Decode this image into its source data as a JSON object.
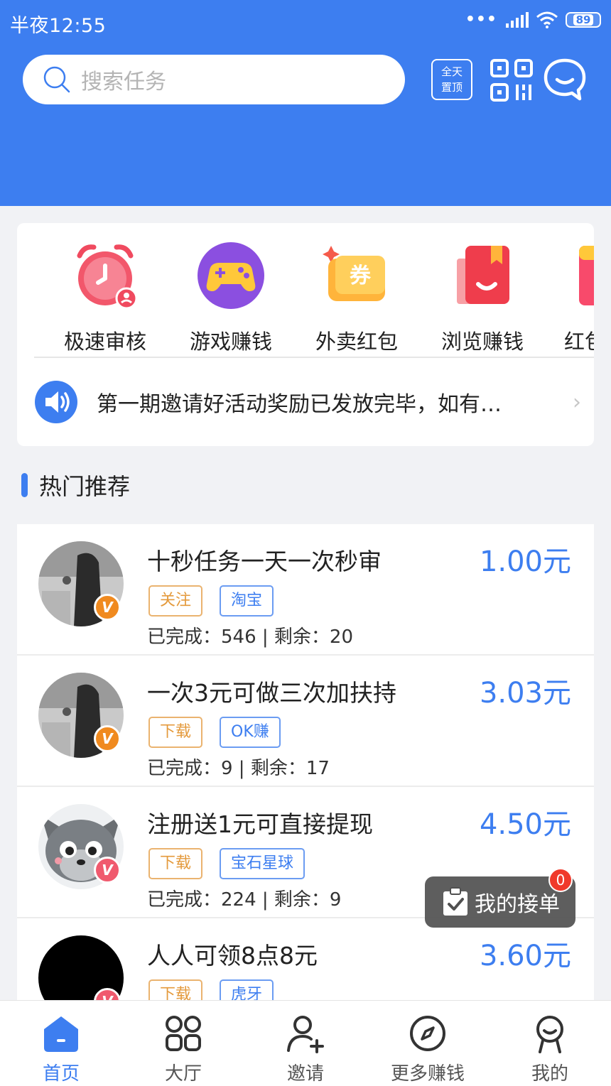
{
  "status_bar": {
    "time": "半夜12:55",
    "signal_dots": "•••",
    "battery": "89"
  },
  "header": {
    "search_placeholder": "搜索任务",
    "pin_button_line1": "全天",
    "pin_button_line2": "置顶",
    "brand_color": "#3d7ef0"
  },
  "categories": [
    {
      "label": "极速审核",
      "icon": "alarm-clock-icon"
    },
    {
      "label": "游戏赚钱",
      "icon": "gamepad-icon"
    },
    {
      "label": "外卖红包",
      "icon": "coupon-icon"
    },
    {
      "label": "浏览赚钱",
      "icon": "book-icon"
    },
    {
      "label": "红包",
      "icon": "red-envelope-icon"
    }
  ],
  "notice": {
    "text": "第一期邀请好活动奖励已发放完毕，如有…",
    "icon": "speaker-icon"
  },
  "section": {
    "title": "热门推荐"
  },
  "tasks": [
    {
      "title": "十秒任务一天一次秒审",
      "price": "1.00元",
      "tags": [
        "关注",
        "淘宝"
      ],
      "stats": "已完成：546 | 剩余：20",
      "badge": "V"
    },
    {
      "title": "一次3元可做三次加扶持",
      "price": "3.03元",
      "tags": [
        "下载",
        "OK赚"
      ],
      "stats": "已完成：9 | 剩余：17",
      "badge": "V"
    },
    {
      "title": "注册送1元可直接提现",
      "price": "4.50元",
      "tags": [
        "下载",
        "宝石星球"
      ],
      "stats": "已完成：224 | 剩余：9",
      "badge": "V"
    },
    {
      "title": "人人可领8点8元",
      "price": "3.60元",
      "tags": [
        "下载",
        "虎牙"
      ],
      "stats": "",
      "badge": "V"
    }
  ],
  "floating_button": {
    "label": "我的接单",
    "count": "0"
  },
  "tabbar": [
    {
      "label": "首页",
      "icon": "home-icon",
      "active": true
    },
    {
      "label": "大厅",
      "icon": "grid-icon",
      "active": false
    },
    {
      "label": "邀请",
      "icon": "add-user-icon",
      "active": false
    },
    {
      "label": "更多赚钱",
      "icon": "compass-icon",
      "active": false
    },
    {
      "label": "我的",
      "icon": "profile-icon",
      "active": false
    }
  ]
}
